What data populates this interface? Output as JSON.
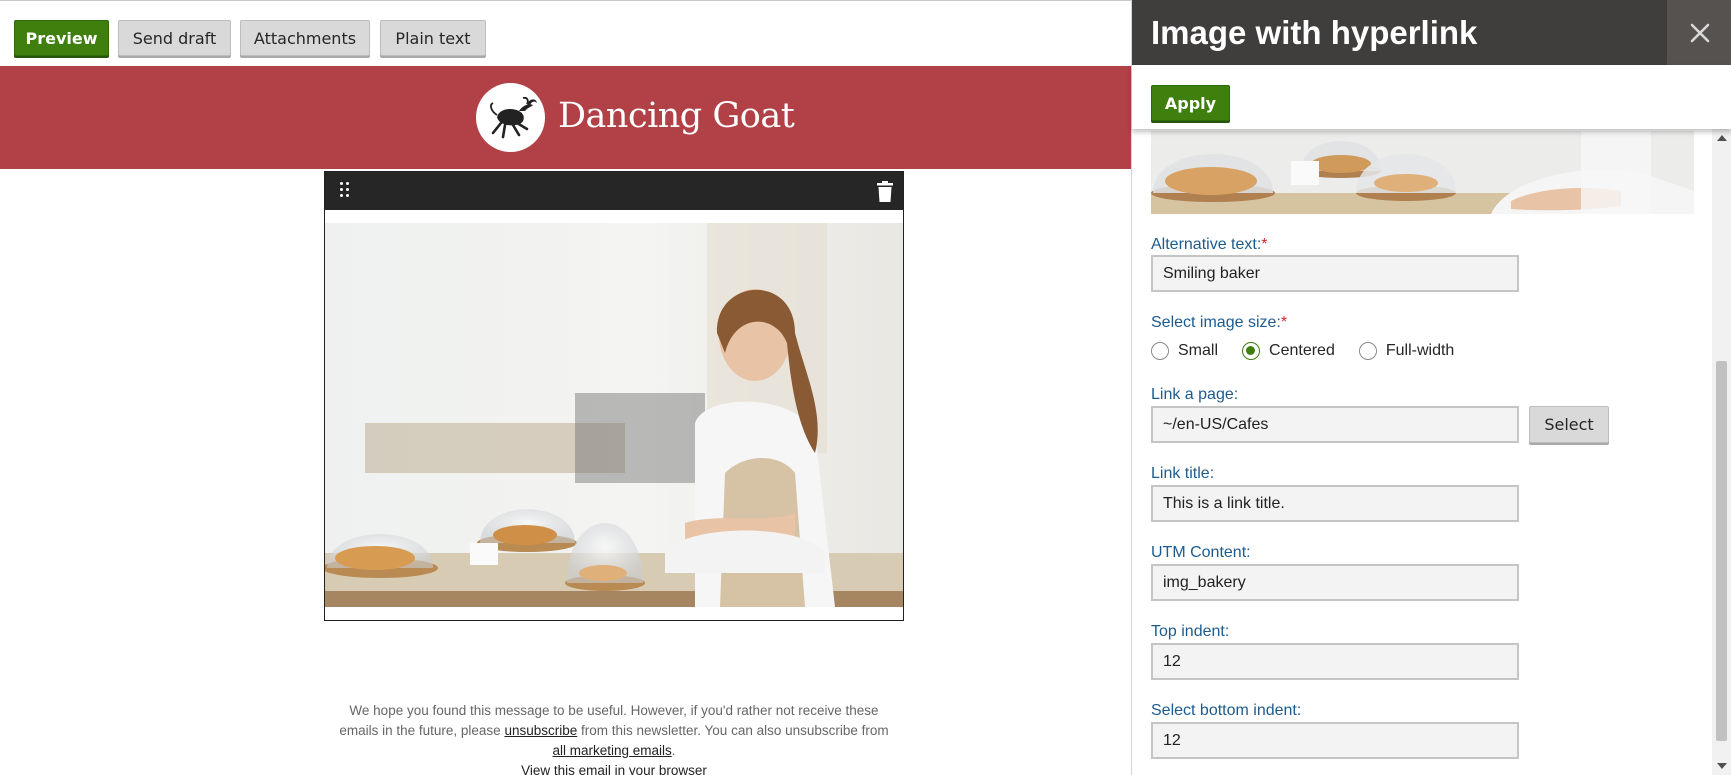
{
  "toolbar": {
    "preview_label": "Preview",
    "send_draft_label": "Send draft",
    "attachments_label": "Attachments",
    "plain_text_label": "Plain text"
  },
  "email": {
    "brand_name": "Dancing Goat",
    "footer": {
      "line1": "We hope you found this message to be useful. However, if you'd rather not receive these",
      "line2_pre": "emails in the future, please ",
      "unsubscribe_link": "unsubscribe",
      "line2_post": " from this newsletter. You can also unsubscribe from",
      "all_marketing_link": "all marketing emails",
      "period": ".",
      "view_in_browser": "View this email in your browser"
    }
  },
  "panel": {
    "title": "Image with hyperlink",
    "apply_label": "Apply",
    "fields": {
      "alt_text": {
        "label": "Alternative text:",
        "required": "*",
        "value": "Smiling baker"
      },
      "image_size": {
        "label": "Select image size:",
        "required": "*",
        "options": [
          "Small",
          "Centered",
          "Full-width"
        ],
        "selected": "Centered"
      },
      "link_page": {
        "label": "Link a page:",
        "value": "~/en-US/Cafes",
        "select_label": "Select"
      },
      "link_title": {
        "label": "Link title:",
        "value": "This is a link title."
      },
      "utm_content": {
        "label": "UTM Content:",
        "value": "img_bakery"
      },
      "top_indent": {
        "label": "Top indent:",
        "value": "12"
      },
      "bottom_indent": {
        "label": "Select bottom indent:",
        "value": "12"
      }
    }
  },
  "colors": {
    "accent_green": "#3e7f0e",
    "banner_red": "#b14047",
    "panel_header": "#403e3d",
    "label_blue": "#1d5b8f"
  }
}
